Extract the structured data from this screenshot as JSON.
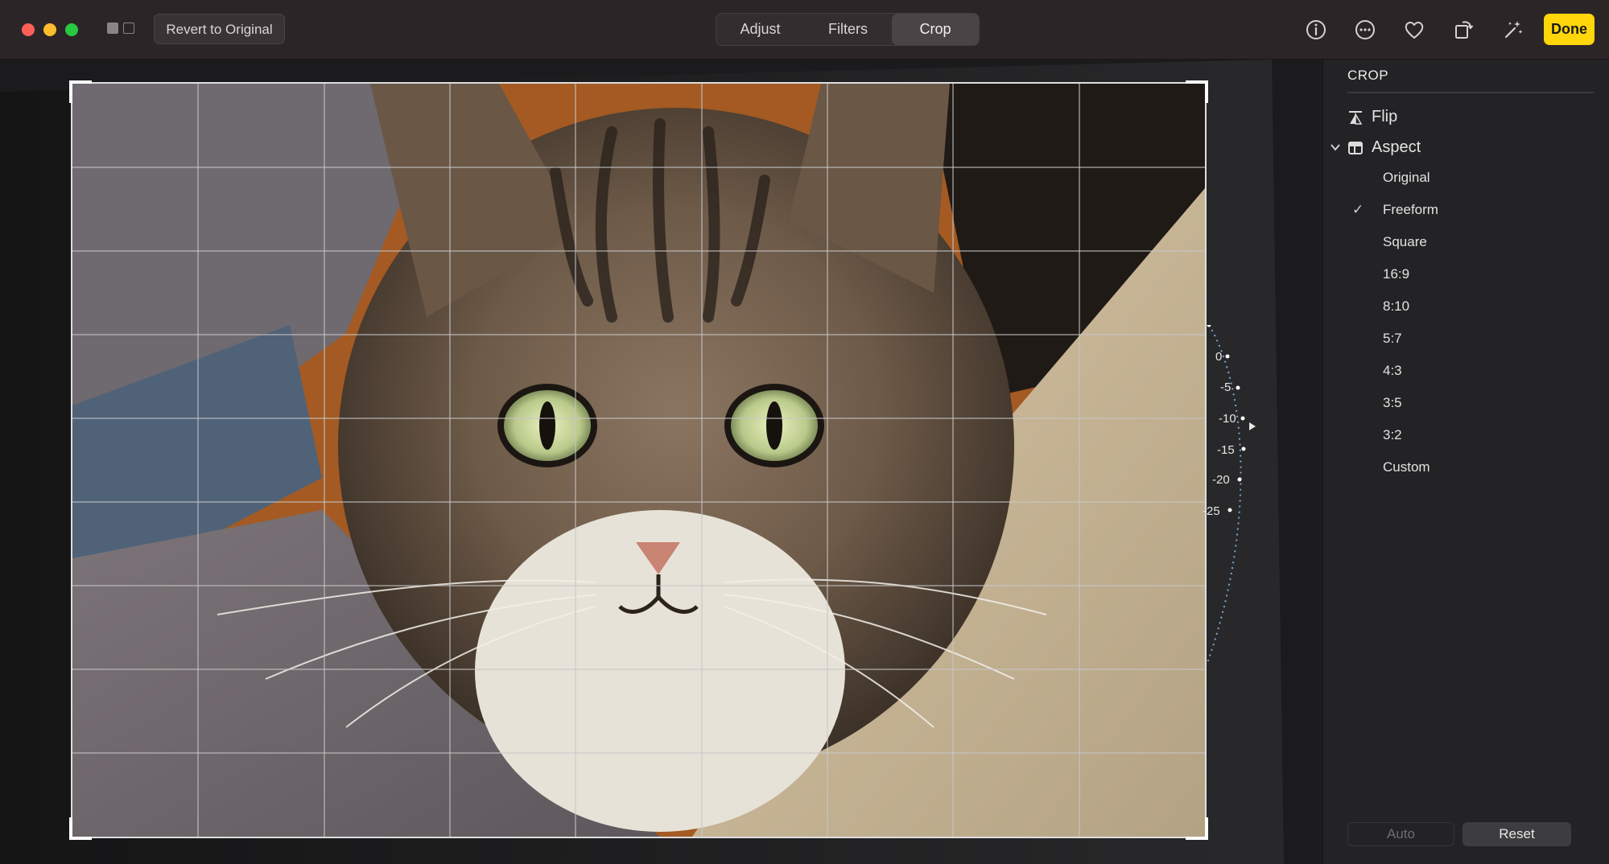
{
  "toolbar": {
    "revert_label": "Revert to Original",
    "tabs": [
      {
        "label": "Adjust",
        "active": false
      },
      {
        "label": "Filters",
        "active": false
      },
      {
        "label": "Crop",
        "active": true
      }
    ],
    "icons": [
      "info-icon",
      "more-icon",
      "heart-icon",
      "rotate-icon",
      "magic-wand-icon"
    ],
    "done_label": "Done",
    "accent_color": "#ffd60a"
  },
  "dial": {
    "ticks": [
      "0",
      "-5",
      "-10",
      "-15",
      "-20",
      "-25"
    ],
    "current": "-10"
  },
  "sidebar": {
    "title": "CROP",
    "flip_label": "Flip",
    "aspect_label": "Aspect",
    "aspect_options": [
      "Original",
      "Freeform",
      "Square",
      "16:9",
      "8:10",
      "5:7",
      "4:3",
      "3:5",
      "3:2",
      "Custom"
    ],
    "selected_aspect": "Freeform",
    "auto_label": "Auto",
    "reset_label": "Reset"
  }
}
